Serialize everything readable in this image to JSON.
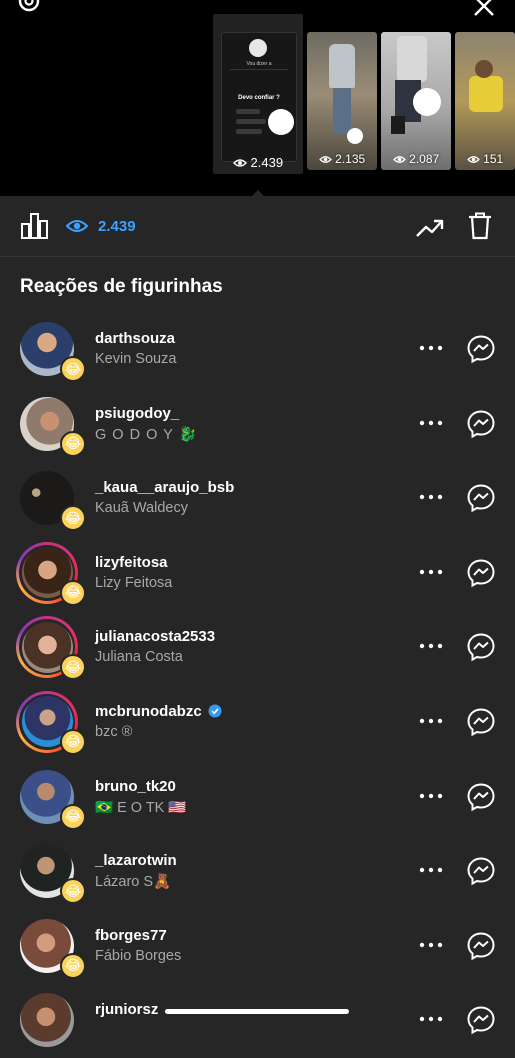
{
  "header": {
    "thumbnails": [
      {
        "views": "2.439",
        "selected": true,
        "preview": {
          "title": "Vou dizer a",
          "caption": "Devo confiar ?"
        }
      },
      {
        "views": "2.135"
      },
      {
        "views": "2.087"
      },
      {
        "views": "151"
      }
    ]
  },
  "toolbar": {
    "views_count": "2.439"
  },
  "section_title": "Reações de figurinhas",
  "rows": [
    {
      "username": "darthsouza",
      "fullname": "Kevin Souza",
      "verified": false,
      "story_ring": false
    },
    {
      "username": "psiugodoy_",
      "fullname": "G O D O Y 🐉",
      "verified": false,
      "story_ring": false
    },
    {
      "username": "_kaua__araujo_bsb",
      "fullname": "Kauã Waldecy",
      "verified": false,
      "story_ring": false
    },
    {
      "username": "lizyfeitosa",
      "fullname": "Lizy Feitosa",
      "verified": false,
      "story_ring": true
    },
    {
      "username": "julianacosta2533",
      "fullname": "Juliana Costa",
      "verified": false,
      "story_ring": true
    },
    {
      "username": "mcbrunodabzc",
      "fullname": "bzc ®",
      "verified": true,
      "story_ring": true
    },
    {
      "username": "bruno_tk20",
      "fullname": "🇧🇷 E O TK 🇺🇸",
      "verified": false,
      "story_ring": false
    },
    {
      "username": "_lazarotwin",
      "fullname": "Lázaro S🧸",
      "verified": false,
      "story_ring": false
    },
    {
      "username": "fborges77",
      "fullname": "Fábio Borges",
      "verified": false,
      "story_ring": false
    },
    {
      "username": "rjuniorsz",
      "fullname": "",
      "verified": false,
      "story_ring": false
    }
  ],
  "colors": {
    "background": "#262626",
    "header_background": "#000000",
    "accent_blue": "#3aa3ff",
    "secondary_text": "#a8a8a8",
    "reaction_emoji": "😂"
  },
  "icons": {
    "settings": "gear-icon",
    "close": "close-icon",
    "insights": "bar-chart-icon",
    "views": "eye-icon",
    "promote": "trending-up-icon",
    "delete": "trash-icon",
    "more": "more-options-icon",
    "message": "messenger-icon"
  }
}
